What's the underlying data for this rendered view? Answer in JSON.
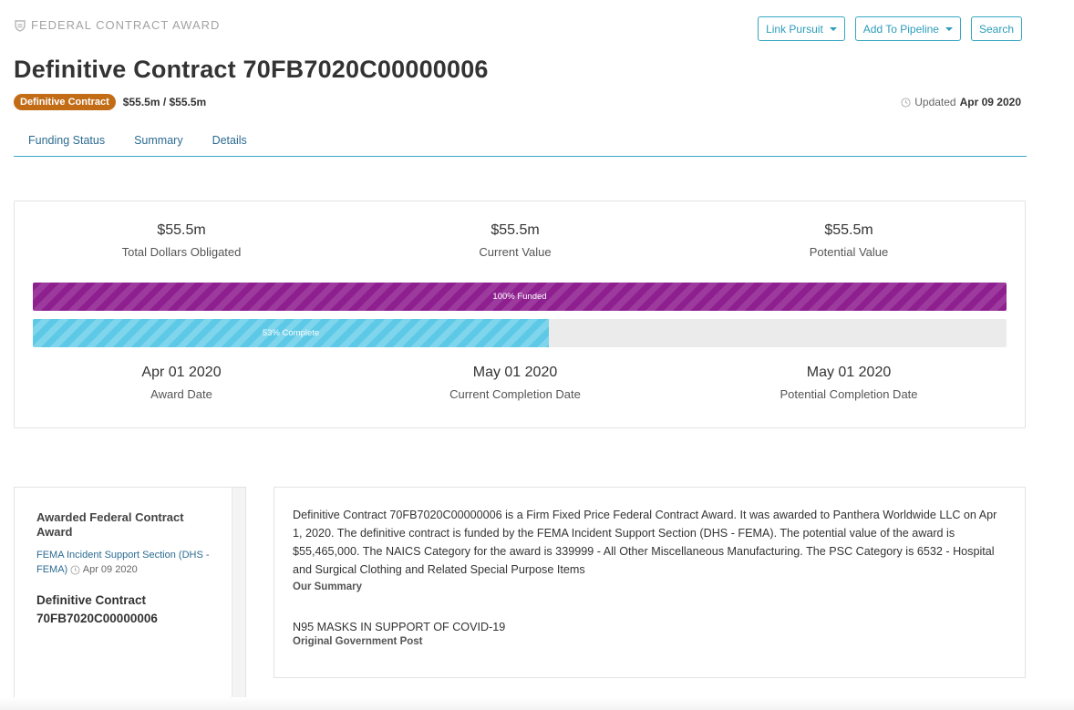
{
  "header": {
    "eyebrow": "FEDERAL CONTRACT AWARD",
    "title": "Definitive Contract 70FB7020C00000006",
    "badge": "Definitive Contract",
    "amount": "$55.5m / $55.5m",
    "updated_prefix": "Updated",
    "updated_date": "Apr 09 2020",
    "icons": {
      "eyebrow": "shield-icon",
      "updated": "clock-icon"
    }
  },
  "actions": {
    "link_pursuit": "Link Pursuit",
    "add_to_pipeline": "Add To Pipeline",
    "search": "Search"
  },
  "tabs": [
    {
      "label": "Funding Status"
    },
    {
      "label": "Summary"
    },
    {
      "label": "Details"
    }
  ],
  "funding": {
    "stats_top": [
      {
        "value": "$55.5m",
        "label": "Total Dollars Obligated"
      },
      {
        "value": "$55.5m",
        "label": "Current Value"
      },
      {
        "value": "$55.5m",
        "label": "Potential Value"
      }
    ],
    "funded_label": "100% Funded",
    "funded_pct": 100,
    "complete_label": "53% Complete",
    "complete_pct": 53,
    "stats_bottom": [
      {
        "value": "Apr 01 2020",
        "label": "Award Date"
      },
      {
        "value": "May 01 2020",
        "label": "Current Completion Date"
      },
      {
        "value": "May 01 2020",
        "label": "Potential Completion Date"
      }
    ]
  },
  "sidebar": {
    "title": "Awarded Federal Contract Award",
    "agency": "FEMA Incident Support Section (DHS - FEMA)",
    "date": "Apr 09 2020",
    "contract": "Definitive Contract 70FB7020C00000006"
  },
  "summary": {
    "description": "Definitive Contract 70FB7020C00000006 is a Firm Fixed Price Federal Contract Award. It was awarded to Panthera Worldwide LLC on Apr 1, 2020. The definitive contract is funded by the FEMA Incident Support Section (DHS - FEMA). The potential value of the award is $55,465,000. The NAICS Category for the award is 339999 - All Other Miscellaneous Manufacturing. The PSC Category is 6532 - Hospital and Surgical Clothing and Related Special Purpose Items",
    "our_summary_label": "Our Summary",
    "post_text": "N95 MASKS IN SUPPORT OF COVID-19",
    "post_label": "Original Government Post"
  },
  "colors": {
    "accent": "#36a7c3",
    "badge": "#c26c16",
    "funded_bar": "#8e1f8f",
    "complete_bar": "#5dc9e6"
  }
}
